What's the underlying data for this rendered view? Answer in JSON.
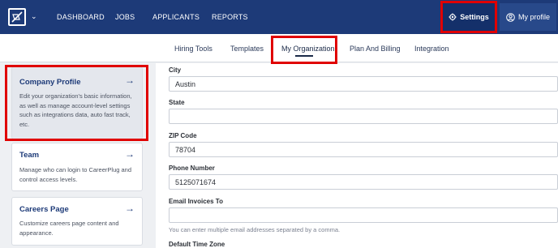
{
  "topnav": {
    "items": [
      "DASHBOARD",
      "JOBS",
      "APPLICANTS",
      "REPORTS"
    ],
    "settings_label": "Settings",
    "profile_label": "My profile"
  },
  "subtabs": [
    "Hiring Tools",
    "Templates",
    "My Organization",
    "Plan And Billing",
    "Integration"
  ],
  "active_subtab": "My Organization",
  "cards": [
    {
      "title": "Company Profile",
      "desc": "Edit your organization's basic information, as well as manage account-level settings such as integrations data, auto fast track, etc."
    },
    {
      "title": "Team",
      "desc": "Manage who can login to CareerPlug and control access levels."
    },
    {
      "title": "Careers Page",
      "desc": "Customize careers page content and appearance."
    }
  ],
  "form": {
    "city_label": "City",
    "city_value": "Austin",
    "state_label": "State",
    "state_value": "",
    "zip_label": "ZIP Code",
    "zip_value": "78704",
    "phone_label": "Phone Number",
    "phone_value": "5125071674",
    "email_invoices_label": "Email Invoices To",
    "email_invoices_value": "",
    "email_invoices_hint": "You can enter multiple email addresses separated by a comma.",
    "timezone_label": "Default Time Zone"
  },
  "colors": {
    "nav_bg": "#1d3a78",
    "highlight": "#e00000",
    "accent": "#1d3a78"
  }
}
